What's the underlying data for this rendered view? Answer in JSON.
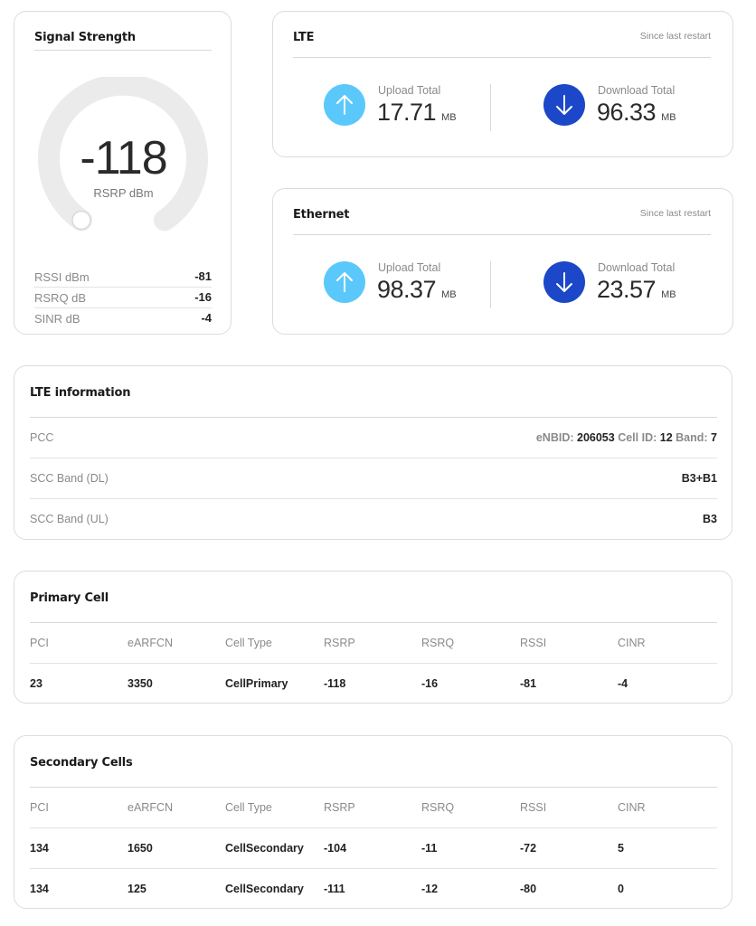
{
  "signal": {
    "title": "Signal Strength",
    "rsrp_value": "-118",
    "rsrp_unit": "RSRP dBm",
    "gauge_level": 0.14,
    "metrics": [
      {
        "label": "RSSI dBm",
        "value": "-81"
      },
      {
        "label": "RSRQ dB",
        "value": "-16"
      },
      {
        "label": "SINR dB",
        "value": "-4"
      }
    ]
  },
  "lte_traffic": {
    "title": "LTE",
    "since": "Since last restart",
    "upload": {
      "label": "Upload Total",
      "value": "17.71",
      "unit": "MB"
    },
    "download": {
      "label": "Download Total",
      "value": "96.33",
      "unit": "MB"
    }
  },
  "ethernet_traffic": {
    "title": "Ethernet",
    "since": "Since last restart",
    "upload": {
      "label": "Upload Total",
      "value": "98.37",
      "unit": "MB"
    },
    "download": {
      "label": "Download Total",
      "value": "23.57",
      "unit": "MB"
    }
  },
  "lte_info": {
    "title": "LTE information",
    "rows": [
      {
        "label": "PCC",
        "enbid_label": "eNBID:",
        "enbid": "206053",
        "cellid_label": "Cell ID:",
        "cellid": "12",
        "band_label": "Band:",
        "band": "7"
      },
      {
        "label": "SCC Band (DL)",
        "value": "B3+B1"
      },
      {
        "label": "SCC Band (UL)",
        "value": "B3"
      }
    ]
  },
  "primary_cell": {
    "title": "Primary Cell",
    "columns": [
      "PCI",
      "eARFCN",
      "Cell Type",
      "RSRP",
      "RSRQ",
      "RSSI",
      "CINR"
    ],
    "rows": [
      [
        "23",
        "3350",
        "CellPrimary",
        "-118",
        "-16",
        "-81",
        "-4"
      ]
    ]
  },
  "secondary_cells": {
    "title": "Secondary Cells",
    "columns": [
      "PCI",
      "eARFCN",
      "Cell Type",
      "RSRP",
      "RSRQ",
      "RSSI",
      "CINR"
    ],
    "rows": [
      [
        "134",
        "1650",
        "CellSecondary",
        "-104",
        "-11",
        "-72",
        "5"
      ],
      [
        "134",
        "125",
        "CellSecondary",
        "-111",
        "-12",
        "-80",
        "0"
      ]
    ]
  },
  "colors": {
    "upload_circle": "#5ac8fa",
    "download_circle": "#1b47c8",
    "gauge_track": "#ebebeb"
  },
  "icons": {
    "upload": "arrow-up-icon",
    "download": "arrow-down-icon"
  }
}
